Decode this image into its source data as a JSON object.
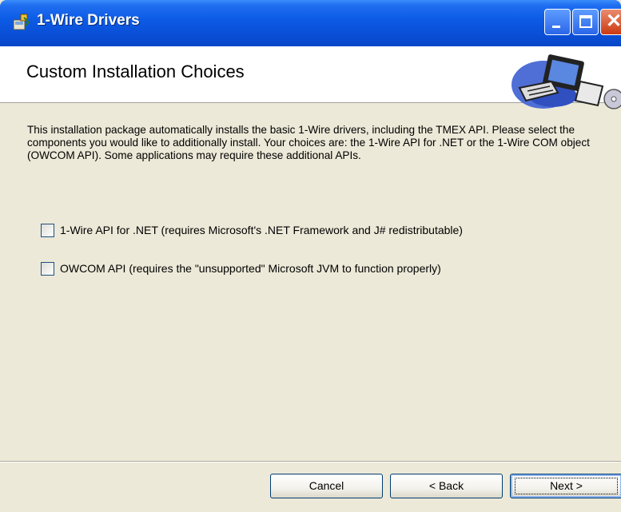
{
  "window": {
    "title": "1-Wire Drivers"
  },
  "header": {
    "heading": "Custom Installation Choices"
  },
  "body": {
    "description": "This installation package automatically installs the basic 1-Wire drivers, including the TMEX API. Please select the components you would like to additionally install.  Your choices are:  the 1-Wire API for .NET or the 1-Wire COM object (OWCOM API).  Some applications may require these additional APIs.",
    "options": [
      {
        "label": "1-Wire API for .NET (requires Microsoft's .NET Framework and J# redistributable)",
        "checked": false
      },
      {
        "label": "OWCOM API (requires the \"unsupported\" Microsoft JVM to function properly)",
        "checked": false
      }
    ]
  },
  "buttons": {
    "cancel": "Cancel",
    "back": "< Back",
    "next": "Next >"
  },
  "icons": {
    "app": "installer-package-icon",
    "banner": "computer-clipart-icon",
    "minimize": "minimize-icon",
    "maximize": "maximize-icon",
    "close": "close-icon"
  },
  "colors": {
    "titlebar": "#0a50d8",
    "face": "#ece9d8",
    "close_button": "#cc3a10"
  }
}
